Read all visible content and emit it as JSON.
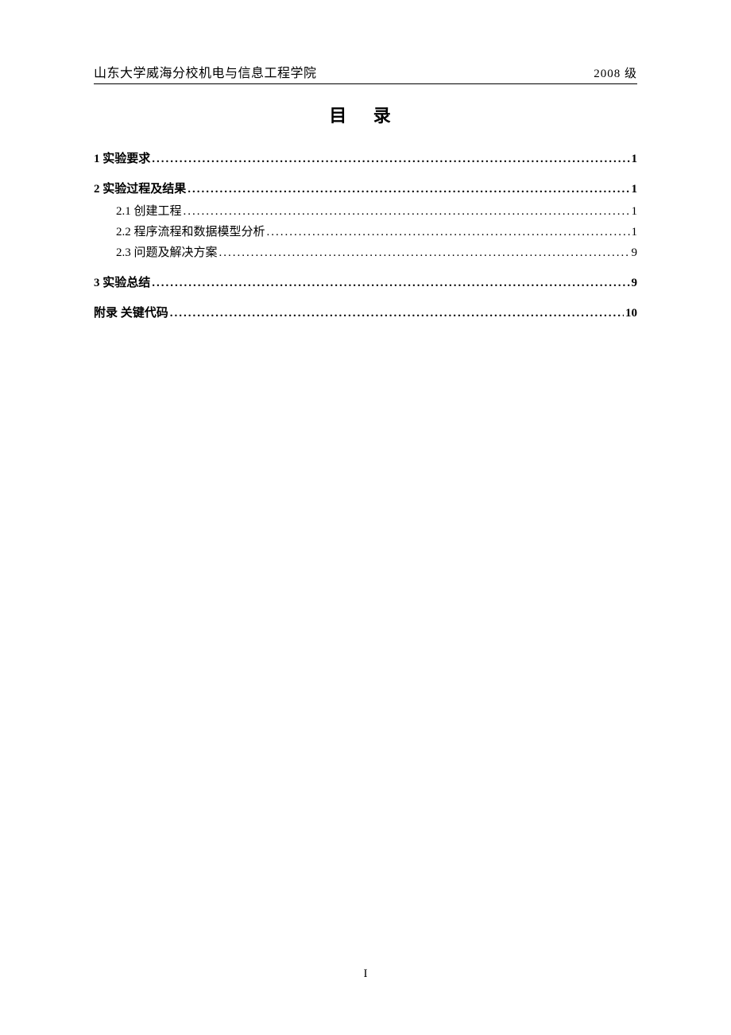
{
  "header": {
    "left": "山东大学威海分校机电与信息工程学院",
    "right": "2008 级"
  },
  "title": "目 录",
  "toc": [
    {
      "level": 1,
      "label": "1  实验要求",
      "page": "1"
    },
    {
      "level": 1,
      "label": "2  实验过程及结果",
      "page": "1"
    },
    {
      "level": 2,
      "label": "2.1  创建工程",
      "page": "1"
    },
    {
      "level": 2,
      "label": "2.2  程序流程和数据模型分析",
      "page": "1"
    },
    {
      "level": 2,
      "label": "2.3  问题及解决方案",
      "page": "9"
    },
    {
      "level": 1,
      "label": "3  实验总结",
      "page": "9"
    },
    {
      "level": 1,
      "label": "附录  关键代码",
      "page": "10"
    }
  ],
  "footer": "I",
  "dots": "................................................................................................................................................................................................"
}
